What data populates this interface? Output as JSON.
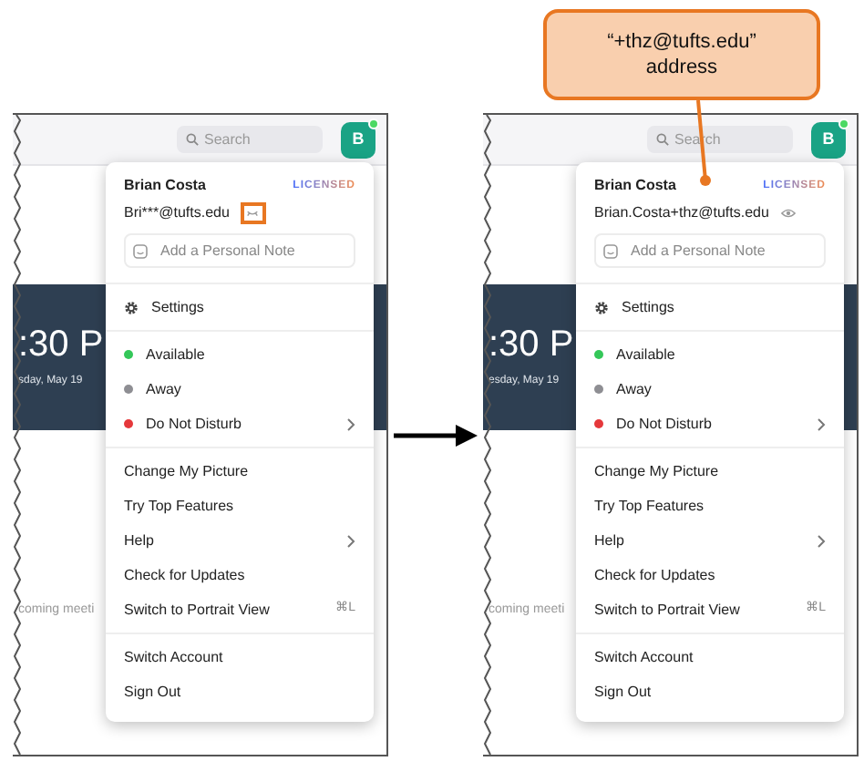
{
  "callout": {
    "text": "“+thz@tufts.edu”\naddress"
  },
  "panels": [
    {
      "search": {
        "placeholder": "Search"
      },
      "avatar": "B",
      "clock": ":30 P",
      "date": "sday, May 19",
      "upcoming": "coming meeti",
      "menu": {
        "name": "Brian Costa",
        "badge": "LICENSED",
        "email": "Bri***@tufts.edu",
        "email_shown": false,
        "email_highlighted": true,
        "note": {
          "placeholder": "Add a Personal Note"
        },
        "sections": [
          {
            "items": [
              {
                "kind": "settings",
                "label": "Settings"
              }
            ]
          },
          {
            "items": [
              {
                "kind": "status",
                "label": "Available",
                "color": "#34c759",
                "submenu": false
              },
              {
                "kind": "status",
                "label": "Away",
                "color": "#8e8e93",
                "submenu": false
              },
              {
                "kind": "status",
                "label": "Do Not Disturb",
                "color": "#e5383b",
                "submenu": true
              }
            ]
          },
          {
            "items": [
              {
                "kind": "plain",
                "label": "Change My Picture",
                "submenu": false
              },
              {
                "kind": "plain",
                "label": "Try Top Features",
                "submenu": false
              },
              {
                "kind": "plain",
                "label": "Help",
                "submenu": true
              },
              {
                "kind": "plain",
                "label": "Check for Updates",
                "submenu": false
              },
              {
                "kind": "plain",
                "label": "Switch to Portrait View",
                "shortcut": "⌘L",
                "submenu": false
              }
            ]
          },
          {
            "items": [
              {
                "kind": "plain",
                "label": "Switch Account",
                "submenu": false
              },
              {
                "kind": "plain",
                "label": "Sign Out",
                "submenu": false
              }
            ]
          }
        ]
      }
    },
    {
      "search": {
        "placeholder": "Search"
      },
      "avatar": "B",
      "clock": ":30 P",
      "date": "esday, May 19",
      "upcoming": "coming meeti",
      "menu": {
        "name": "Brian Costa",
        "badge": "LICENSED",
        "email": "Brian.Costa+thz@tufts.edu",
        "email_shown": true,
        "email_highlighted": false,
        "note": {
          "placeholder": "Add a Personal Note"
        },
        "sections": [
          {
            "items": [
              {
                "kind": "settings",
                "label": "Settings"
              }
            ]
          },
          {
            "items": [
              {
                "kind": "status",
                "label": "Available",
                "color": "#34c759",
                "submenu": false
              },
              {
                "kind": "status",
                "label": "Away",
                "color": "#8e8e93",
                "submenu": false
              },
              {
                "kind": "status",
                "label": "Do Not Disturb",
                "color": "#e5383b",
                "submenu": true
              }
            ]
          },
          {
            "items": [
              {
                "kind": "plain",
                "label": "Change My Picture",
                "submenu": false
              },
              {
                "kind": "plain",
                "label": "Try Top Features",
                "submenu": false
              },
              {
                "kind": "plain",
                "label": "Help",
                "submenu": true
              },
              {
                "kind": "plain",
                "label": "Check for Updates",
                "submenu": false
              },
              {
                "kind": "plain",
                "label": "Switch to Portrait View",
                "shortcut": "⌘L",
                "submenu": false
              }
            ]
          },
          {
            "items": [
              {
                "kind": "plain",
                "label": "Switch Account",
                "submenu": false
              },
              {
                "kind": "plain",
                "label": "Sign Out",
                "submenu": false
              }
            ]
          }
        ]
      }
    }
  ]
}
